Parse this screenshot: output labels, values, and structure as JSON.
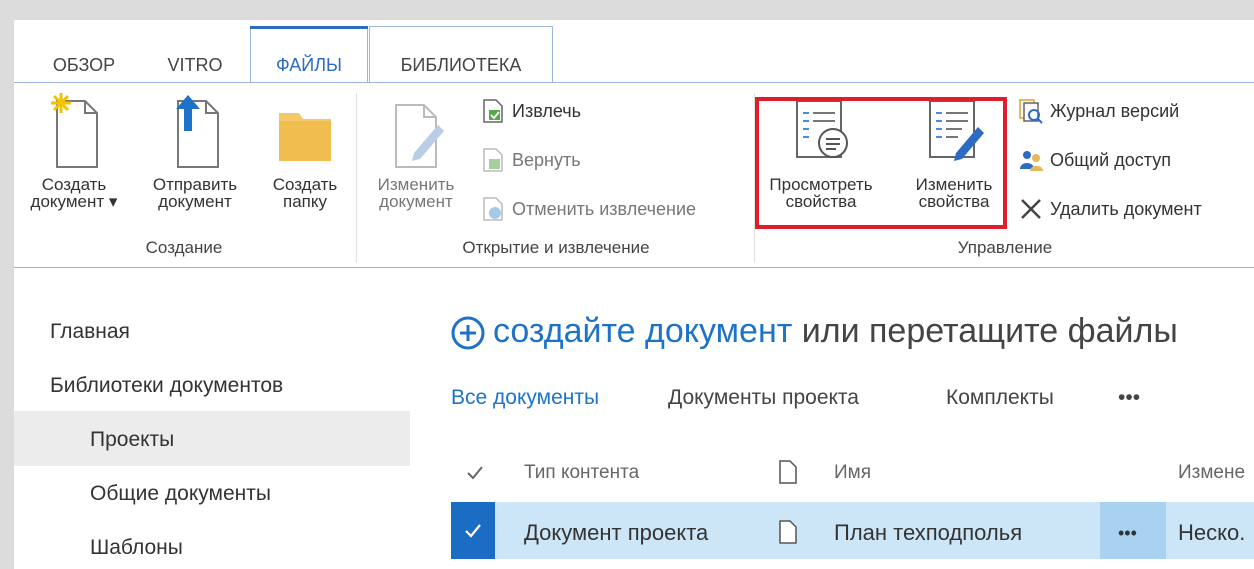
{
  "tabs": [
    {
      "label": "ОБЗОР"
    },
    {
      "label": "VITRO"
    },
    {
      "label": "ФАЙЛЫ"
    },
    {
      "label": "БИБЛИОТЕКА"
    }
  ],
  "ribbon": {
    "groups": {
      "create": {
        "label": "Создание",
        "create_doc": "Создать\nдокумент ▾",
        "upload_doc": "Отправить\nдокумент",
        "create_folder": "Создать\nпапку"
      },
      "open": {
        "label": "Открытие и извлечение",
        "edit_doc": "Изменить\nдокумент",
        "checkout": "Извлечь",
        "checkin": "Вернуть",
        "discard": "Отменить извлечение"
      },
      "manage": {
        "label": "Управление",
        "view_props": "Просмотреть\nсвойства",
        "edit_props": "Изменить\nсвойства",
        "version_history": "Журнал версий",
        "shared_access": "Общий доступ",
        "delete_doc": "Удалить документ"
      }
    },
    "highlight_color": "#e01e2b",
    "accent": "#2b6cc2"
  },
  "nav": {
    "home": "Главная",
    "doc_libraries": "Библиотеки документов",
    "projects": "Проекты",
    "shared_docs": "Общие документы",
    "templates": "Шаблоны"
  },
  "main": {
    "create_link": "создайте документ",
    "create_rest": " или перетащите файлы",
    "views": [
      "Все документы",
      "Документы проекта",
      "Комплекты",
      "•••"
    ],
    "columns": {
      "content_type": "Тип контента",
      "name": "Имя",
      "modified": "Измене"
    },
    "row": {
      "content_type": "Документ проекта",
      "name": "План техподполья",
      "dots": "•••",
      "modified": "Неско."
    }
  }
}
